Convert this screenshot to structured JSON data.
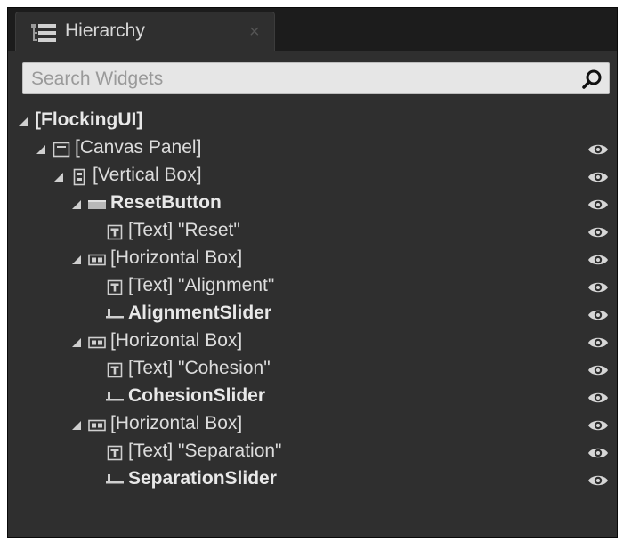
{
  "tab": {
    "title": "Hierarchy",
    "close": "×"
  },
  "search": {
    "placeholder": "Search Widgets"
  },
  "tree": [
    {
      "label": "[FlockingUI]",
      "depth": 0,
      "expanded": true,
      "icon": "",
      "bold": true,
      "eye": false
    },
    {
      "label": "[Canvas Panel]",
      "depth": 1,
      "expanded": true,
      "icon": "canvas-panel-icon",
      "bold": false,
      "eye": true
    },
    {
      "label": "[Vertical Box]",
      "depth": 2,
      "expanded": true,
      "icon": "vertical-box-icon",
      "bold": false,
      "eye": true
    },
    {
      "label": "ResetButton",
      "depth": 3,
      "expanded": true,
      "icon": "button-icon",
      "bold": true,
      "eye": true
    },
    {
      "label": "[Text] \"Reset\"",
      "depth": 4,
      "expanded": false,
      "icon": "text-icon",
      "bold": false,
      "eye": true
    },
    {
      "label": "[Horizontal Box]",
      "depth": 3,
      "expanded": true,
      "icon": "horizontal-box-icon",
      "bold": false,
      "eye": true
    },
    {
      "label": "[Text] \"Alignment\"",
      "depth": 4,
      "expanded": false,
      "icon": "text-icon",
      "bold": false,
      "eye": true
    },
    {
      "label": "AlignmentSlider",
      "depth": 4,
      "expanded": false,
      "icon": "slider-icon",
      "bold": true,
      "eye": true
    },
    {
      "label": "[Horizontal Box]",
      "depth": 3,
      "expanded": true,
      "icon": "horizontal-box-icon",
      "bold": false,
      "eye": true
    },
    {
      "label": "[Text] \"Cohesion\"",
      "depth": 4,
      "expanded": false,
      "icon": "text-icon",
      "bold": false,
      "eye": true
    },
    {
      "label": "CohesionSlider",
      "depth": 4,
      "expanded": false,
      "icon": "slider-icon",
      "bold": true,
      "eye": true
    },
    {
      "label": "[Horizontal Box]",
      "depth": 3,
      "expanded": true,
      "icon": "horizontal-box-icon",
      "bold": false,
      "eye": true
    },
    {
      "label": "[Text] \"Separation\"",
      "depth": 4,
      "expanded": false,
      "icon": "text-icon",
      "bold": false,
      "eye": true
    },
    {
      "label": "SeparationSlider",
      "depth": 4,
      "expanded": false,
      "icon": "slider-icon",
      "bold": true,
      "eye": true
    }
  ]
}
